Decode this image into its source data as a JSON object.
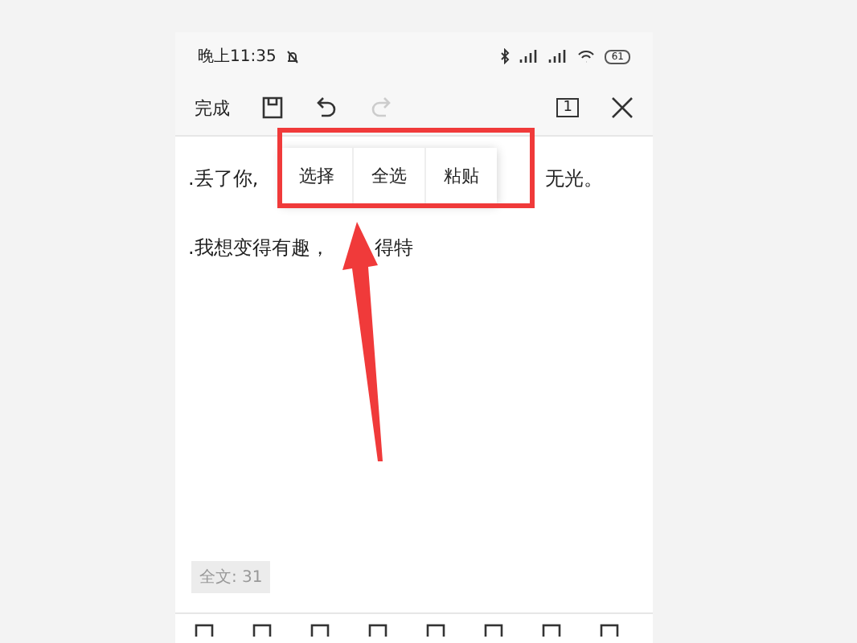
{
  "status_bar": {
    "time": "晚上11:35",
    "battery": "61"
  },
  "toolbar": {
    "done": "完成",
    "page_count": "1"
  },
  "document": {
    "lines": [
      {
        "visible_parts": [
          ".丢了你,",
          "无光。"
        ]
      },
      {
        "visible_parts": [
          ".我想变得有趣，",
          "得特"
        ]
      }
    ]
  },
  "context_menu": {
    "items": [
      "选择",
      "全选",
      "粘贴"
    ]
  },
  "word_count": "全文: 31"
}
